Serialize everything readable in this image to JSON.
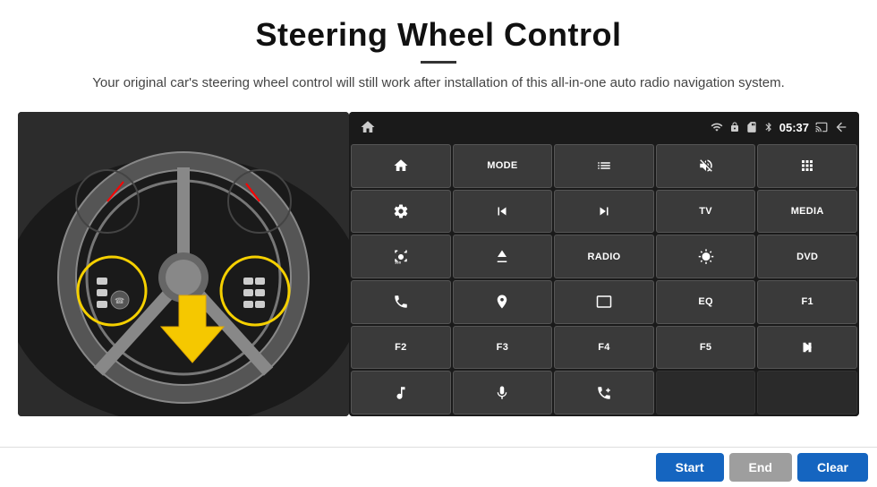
{
  "header": {
    "title": "Steering Wheel Control",
    "description": "Your original car's steering wheel control will still work after installation of this all-in-one auto radio navigation system."
  },
  "status_bar": {
    "time": "05:37",
    "icons": [
      "wifi",
      "lock",
      "sd",
      "bluetooth",
      "cast",
      "back"
    ]
  },
  "buttons": [
    {
      "id": "row1",
      "cells": [
        {
          "label": "home",
          "type": "icon"
        },
        {
          "label": "MODE",
          "type": "text"
        },
        {
          "label": "list",
          "type": "icon"
        },
        {
          "label": "mute",
          "type": "icon"
        },
        {
          "label": "apps",
          "type": "icon"
        }
      ]
    },
    {
      "id": "row2",
      "cells": [
        {
          "label": "settings",
          "type": "icon"
        },
        {
          "label": "prev",
          "type": "icon"
        },
        {
          "label": "next",
          "type": "icon"
        },
        {
          "label": "TV",
          "type": "text"
        },
        {
          "label": "MEDIA",
          "type": "text"
        }
      ]
    },
    {
      "id": "row3",
      "cells": [
        {
          "label": "360cam",
          "type": "icon"
        },
        {
          "label": "eject",
          "type": "icon"
        },
        {
          "label": "RADIO",
          "type": "text"
        },
        {
          "label": "brightness",
          "type": "icon"
        },
        {
          "label": "DVD",
          "type": "text"
        }
      ]
    },
    {
      "id": "row4",
      "cells": [
        {
          "label": "phone",
          "type": "icon"
        },
        {
          "label": "nav",
          "type": "icon"
        },
        {
          "label": "screen",
          "type": "icon"
        },
        {
          "label": "EQ",
          "type": "text"
        },
        {
          "label": "F1",
          "type": "text"
        }
      ]
    },
    {
      "id": "row5",
      "cells": [
        {
          "label": "F2",
          "type": "text"
        },
        {
          "label": "F3",
          "type": "text"
        },
        {
          "label": "F4",
          "type": "text"
        },
        {
          "label": "F5",
          "type": "text"
        },
        {
          "label": "playpause",
          "type": "icon"
        }
      ]
    },
    {
      "id": "row6",
      "cells": [
        {
          "label": "music",
          "type": "icon"
        },
        {
          "label": "mic",
          "type": "icon"
        },
        {
          "label": "call",
          "type": "icon"
        },
        {
          "label": "",
          "type": "empty"
        },
        {
          "label": "",
          "type": "empty"
        }
      ]
    }
  ],
  "bottom_buttons": {
    "start": "Start",
    "end": "End",
    "clear": "Clear"
  }
}
